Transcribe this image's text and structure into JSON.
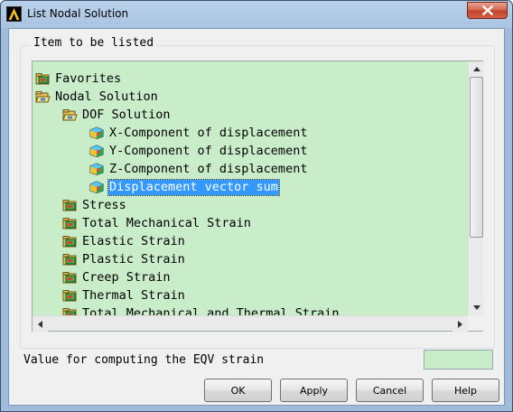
{
  "window": {
    "title": "List Nodal Solution"
  },
  "group": {
    "label": "Item to be listed"
  },
  "tree": {
    "items": [
      {
        "label": "Favorites",
        "icon": "folder-icon",
        "level": 0,
        "selected": false
      },
      {
        "label": "Nodal Solution",
        "icon": "folder-open-icon",
        "level": 0,
        "selected": false
      },
      {
        "label": "DOF Solution",
        "icon": "folder-open-icon",
        "level": 1,
        "selected": false
      },
      {
        "label": "X-Component of displacement",
        "icon": "cube-icon",
        "level": 2,
        "selected": false
      },
      {
        "label": "Y-Component of displacement",
        "icon": "cube-icon",
        "level": 2,
        "selected": false
      },
      {
        "label": "Z-Component of displacement",
        "icon": "cube-icon",
        "level": 2,
        "selected": false
      },
      {
        "label": "Displacement vector sum",
        "icon": "cube-icon",
        "level": 2,
        "selected": true
      },
      {
        "label": "Stress",
        "icon": "folder-icon",
        "level": 1,
        "selected": false
      },
      {
        "label": "Total Mechanical Strain",
        "icon": "folder-icon",
        "level": 1,
        "selected": false
      },
      {
        "label": "Elastic Strain",
        "icon": "folder-icon",
        "level": 1,
        "selected": false
      },
      {
        "label": "Plastic Strain",
        "icon": "folder-icon",
        "level": 1,
        "selected": false
      },
      {
        "label": "Creep Strain",
        "icon": "folder-icon",
        "level": 1,
        "selected": false
      },
      {
        "label": "Thermal Strain",
        "icon": "folder-icon",
        "level": 1,
        "selected": false
      },
      {
        "label": "Total Mechanical and Thermal Strain",
        "icon": "folder-icon",
        "level": 1,
        "selected": false
      }
    ]
  },
  "eqv": {
    "label": "Value for computing the EQV strain",
    "value": ""
  },
  "buttons": {
    "ok": "OK",
    "apply": "Apply",
    "cancel": "Cancel",
    "help": "Help"
  },
  "colors": {
    "tree_background": "#c9ecc9",
    "selection": "#3399ff",
    "title_bar": "#a9c4e2",
    "close_button": "#c2452a"
  }
}
